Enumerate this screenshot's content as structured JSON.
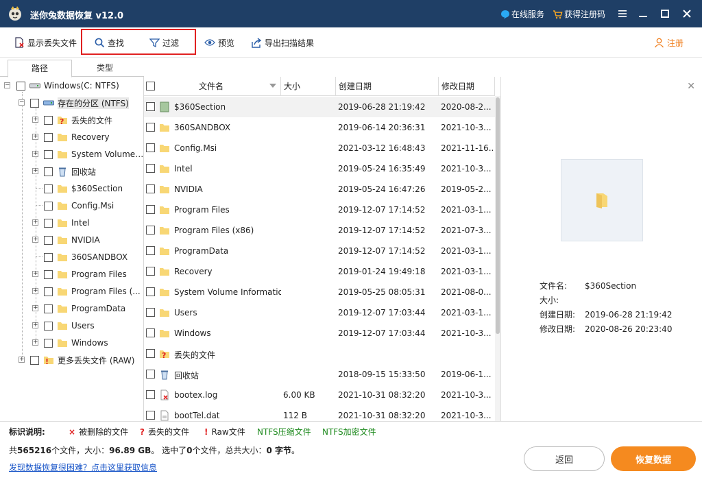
{
  "titlebar": {
    "app_title": "迷你兔数据恢复 v12.0",
    "online_service": "在线服务",
    "get_code": "获得注册码"
  },
  "toolbar": {
    "show_lost": "显示丢失文件",
    "find": "查找",
    "filter": "过滤",
    "preview": "预览",
    "export": "导出扫描结果",
    "register": "注册"
  },
  "tabs": {
    "path": "路径",
    "type": "类型"
  },
  "tree": {
    "drive": "Windows(C: NTFS)",
    "partition": "存在的分区 (NTFS)",
    "items": [
      "丢失的文件",
      "Recovery",
      "System Volume ...",
      "回收站",
      "$360Section",
      "Config.Msi",
      "Intel",
      "NVIDIA",
      "360SANDBOX",
      "Program Files",
      "Program Files (...",
      "ProgramData",
      "Users",
      "Windows"
    ],
    "raw": "更多丢失文件 (RAW)"
  },
  "list": {
    "headers": {
      "name": "文件名",
      "size": "大小",
      "created": "创建日期",
      "modified": "修改日期"
    },
    "rows": [
      {
        "name": "$360Section",
        "size": "",
        "created": "2019-06-28 21:19:42",
        "modified": "2020-08-2..."
      },
      {
        "name": "360SANDBOX",
        "size": "",
        "created": "2019-06-14 20:36:31",
        "modified": "2021-10-3..."
      },
      {
        "name": "Config.Msi",
        "size": "",
        "created": "2021-03-12 16:48:43",
        "modified": "2021-11-16..."
      },
      {
        "name": "Intel",
        "size": "",
        "created": "2019-05-24 16:35:49",
        "modified": "2021-10-3..."
      },
      {
        "name": "NVIDIA",
        "size": "",
        "created": "2019-05-24 16:47:26",
        "modified": "2019-05-2..."
      },
      {
        "name": "Program Files",
        "size": "",
        "created": "2019-12-07 17:14:52",
        "modified": "2021-03-1..."
      },
      {
        "name": "Program Files (x86)",
        "size": "",
        "created": "2019-12-07 17:14:52",
        "modified": "2021-07-3..."
      },
      {
        "name": "ProgramData",
        "size": "",
        "created": "2019-12-07 17:14:52",
        "modified": "2021-03-1..."
      },
      {
        "name": "Recovery",
        "size": "",
        "created": "2019-01-24 19:49:18",
        "modified": "2021-03-1..."
      },
      {
        "name": "System Volume Information",
        "size": "",
        "created": "2019-05-25 08:05:31",
        "modified": "2021-08-0..."
      },
      {
        "name": "Users",
        "size": "",
        "created": "2019-12-07 17:03:44",
        "modified": "2021-03-1..."
      },
      {
        "name": "Windows",
        "size": "",
        "created": "2019-12-07 17:03:44",
        "modified": "2021-10-3..."
      },
      {
        "name": "丢失的文件",
        "size": "",
        "created": "",
        "modified": ""
      },
      {
        "name": "回收站",
        "size": "",
        "created": "2018-09-15 15:33:50",
        "modified": "2019-06-1..."
      },
      {
        "name": "bootex.log",
        "size": "6.00 KB",
        "created": "2021-10-31 08:32:20",
        "modified": "2021-10-3..."
      },
      {
        "name": "bootTel.dat",
        "size": "112 B",
        "created": "2021-10-31 08:32:20",
        "modified": "2021-10-3..."
      }
    ]
  },
  "preview": {
    "name_label": "文件名:",
    "name_value": "$360Section",
    "size_label": "大小:",
    "size_value": "",
    "created_label": "创建日期:",
    "created_value": "2019-06-28 21:19:42",
    "modified_label": "修改日期:",
    "modified_value": "2020-08-26 20:23:40"
  },
  "legend": {
    "title": "标识说明:",
    "deleted": "被删除的文件",
    "lost": "丢失的文件",
    "raw": "Raw文件",
    "compressed": "NTFS压缩文件",
    "encrypted": "NTFS加密文件"
  },
  "status": {
    "summary_pre": "共",
    "total_files": "565216",
    "summary_mid1": "个文件，大小：",
    "total_size": "96.89 GB",
    "summary_mid2": "。 选中了",
    "selected_count": "0",
    "summary_mid3": "个文件，总共大小：",
    "selected_size": "0 字节",
    "summary_end": "。",
    "help_link": "发现数据恢复很困难？点击这里获取信息",
    "back": "返回",
    "recover": "恢复数据"
  },
  "colors": {
    "titlebar": "#1f3f66",
    "accent_orange": "#f58a1f",
    "ntfs_green": "#1e8a1e",
    "link_blue": "#1a56c8",
    "mark_red": "#e02020"
  }
}
